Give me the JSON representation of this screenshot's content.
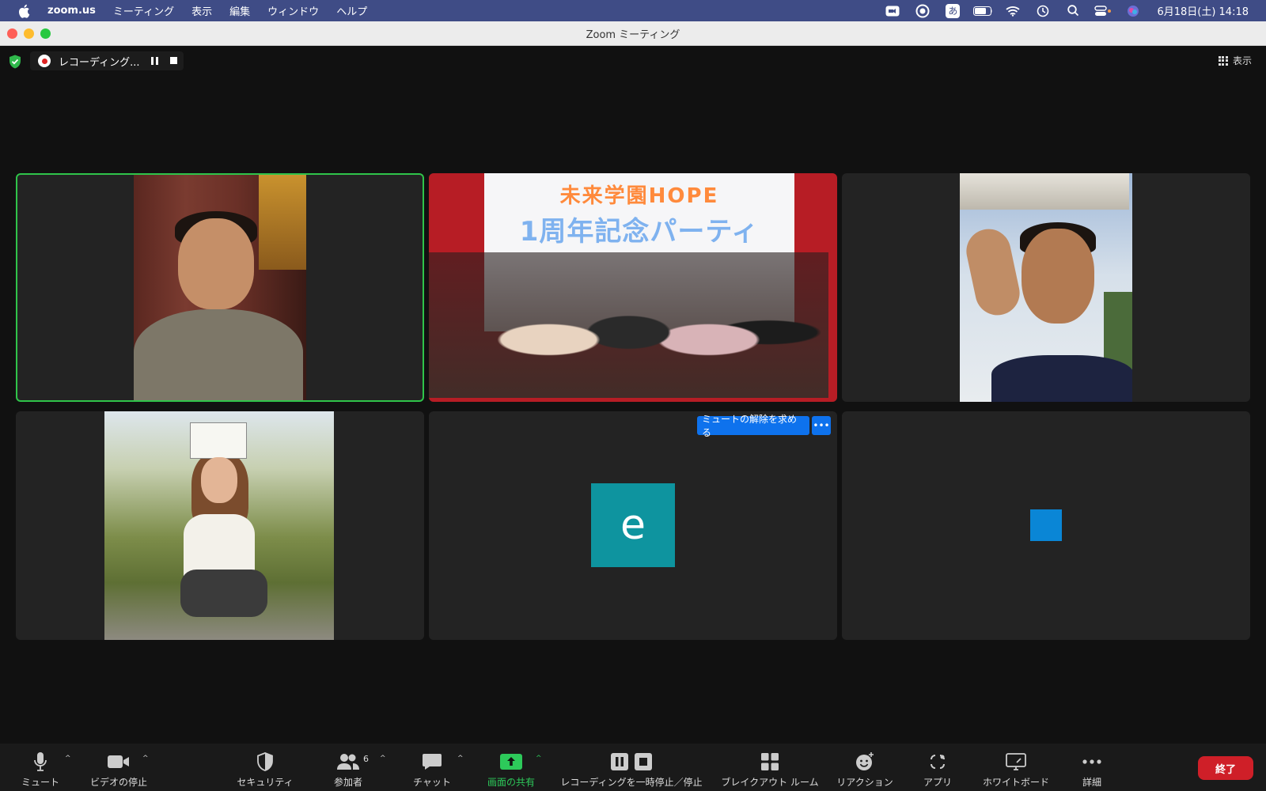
{
  "menubar": {
    "app_name": "zoom.us",
    "items": [
      "ミーティング",
      "表示",
      "編集",
      "ウィンドウ",
      "ヘルプ"
    ],
    "ime_label": "あ",
    "clock": "6月18日(土)  14:18"
  },
  "window": {
    "title": "Zoom ミーティング"
  },
  "recording": {
    "label": "レコーディング..."
  },
  "view": {
    "label": "表示"
  },
  "tiles": {
    "group_banner_title": "未来学園HOPE",
    "group_banner_sub": "1周年記念パーティ",
    "avatar_letter": "e",
    "unmute_request_label": "ミュートの解除を求める",
    "more_label": "•••"
  },
  "toolbar": {
    "mute": "ミュート",
    "video": "ビデオの停止",
    "security": "セキュリティ",
    "participants": "参加者",
    "participants_count": "6",
    "chat": "チャット",
    "share": "画面の共有",
    "recording": "レコーディングを一時停止／停止",
    "breakout": "ブレイクアウト ルーム",
    "reactions": "リアクション",
    "apps": "アプリ",
    "whiteboard": "ホワイトボード",
    "more": "詳細",
    "end": "終了"
  },
  "colors": {
    "menubar": "#3f4c86",
    "active_speaker": "#2fc44a",
    "share_green": "#2dc95a",
    "end_red": "#cf1f28",
    "button_blue": "#0e72ed",
    "avatar_teal": "#0e949f"
  }
}
